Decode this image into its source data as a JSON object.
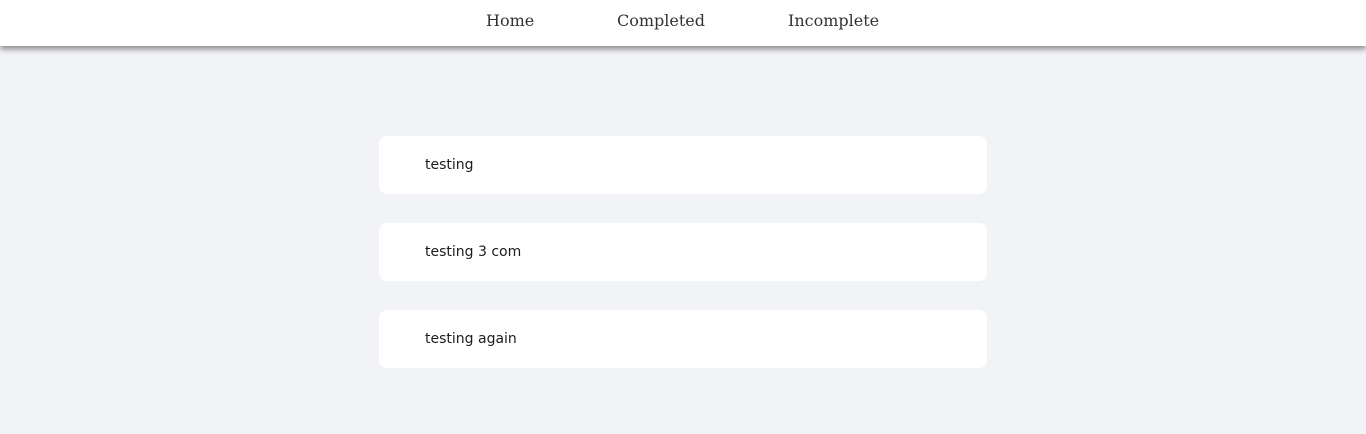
{
  "nav": {
    "items": [
      {
        "label": "Home"
      },
      {
        "label": "Completed"
      },
      {
        "label": "Incomplete"
      }
    ]
  },
  "tasks": [
    {
      "text": "testing"
    },
    {
      "text": "testing 3 com"
    },
    {
      "text": "testing again"
    }
  ],
  "colors": {
    "background": "#f2f3f7",
    "card": "#ffffff",
    "navbar": "#ffffff",
    "text": "#1c1c1c"
  }
}
